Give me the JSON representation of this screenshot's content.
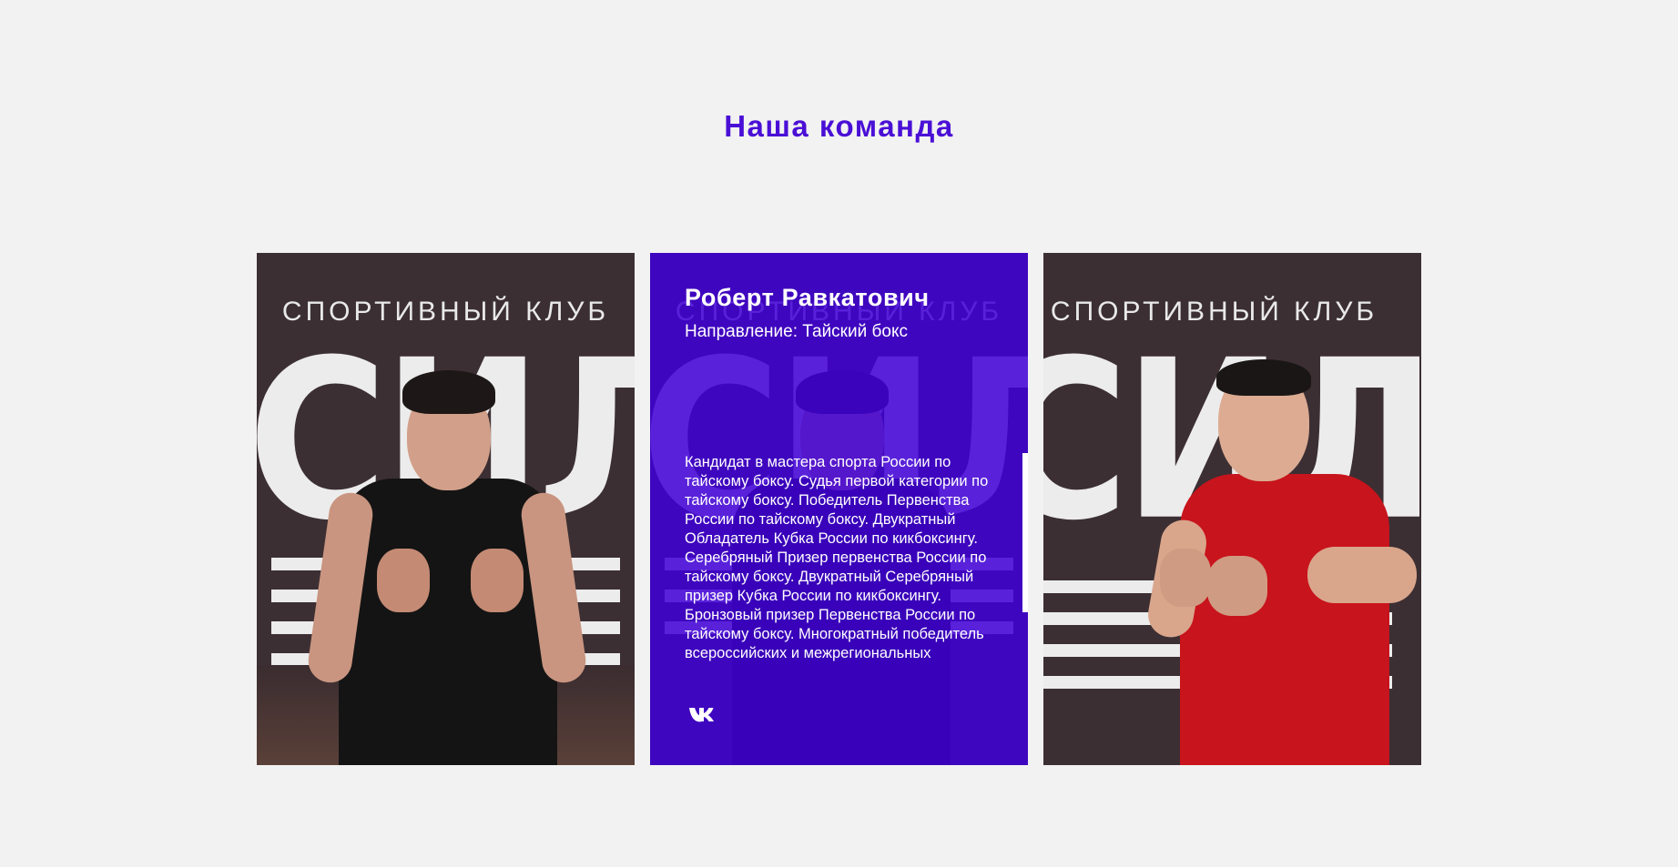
{
  "section": {
    "title": "Наша команда"
  },
  "photo_backdrop": {
    "club_line": "СПОРТИВНЫЙ КЛУБ",
    "club_name": "СИЛА"
  },
  "cards": [
    {
      "name": "",
      "shirt_color": "#151515"
    },
    {
      "name": "Роберт Равкатович",
      "direction": "Направление: Тайский бокс",
      "bio": "Кандидат в мастера спорта России по тайскому боксу. Судья первой категории по тайскому боксу. Победитель Первенства России по тайскому боксу. Двукратный Обладатель Кубка России по кикбоксингу. Серебряный Призер первенства России по тайскому боксу. Двукратный Серебряный призер Кубка России по кикбоксингу. Бронзовый призер Первенства России по тайскому боксу. Многократный победитель всероссийских и межрегиональных",
      "social_icon": "vk-icon",
      "overlay_color": "#4000d6"
    },
    {
      "name": "",
      "shirt_color": "#c8141c"
    }
  ],
  "colors": {
    "accent": "#4a0fd6",
    "background": "#f2f2f2"
  }
}
